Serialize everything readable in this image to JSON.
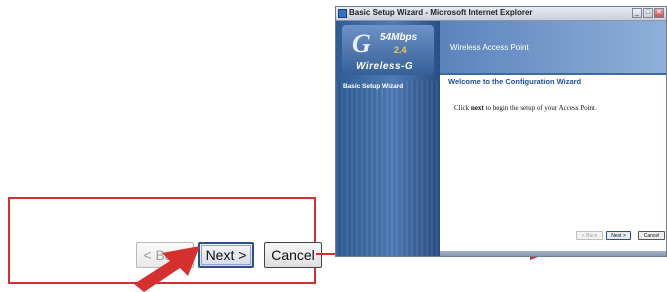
{
  "zoom_callout": {
    "back_label": "< Back",
    "next_label": "Next >",
    "cancel_label": "Cancel"
  },
  "window": {
    "title": "Basic Setup Wizard - Microsoft Internet Explorer",
    "controls": [
      "minimize-icon",
      "maximize-icon",
      "close-icon"
    ]
  },
  "brand": {
    "speed": "54Mbps",
    "band": "2.4",
    "product": "Wireless-G"
  },
  "sidebar": {
    "items": [
      {
        "label": "Basic Setup Wizard"
      }
    ]
  },
  "header": {
    "title": "Wireless Access Point"
  },
  "content": {
    "heading": "Welcome to the Configuration Wizard",
    "body_prefix": "Click ",
    "body_bold": "next",
    "body_suffix": " to begin the setup of your Access Point."
  },
  "wizard_buttons": {
    "back_label": "< Back",
    "next_label": "Next >",
    "cancel_label": "Cancel"
  },
  "colors": {
    "callout_red": "#d3302f",
    "sidebar_blue": "#2f5c93",
    "heading_blue": "#1d4f99"
  }
}
